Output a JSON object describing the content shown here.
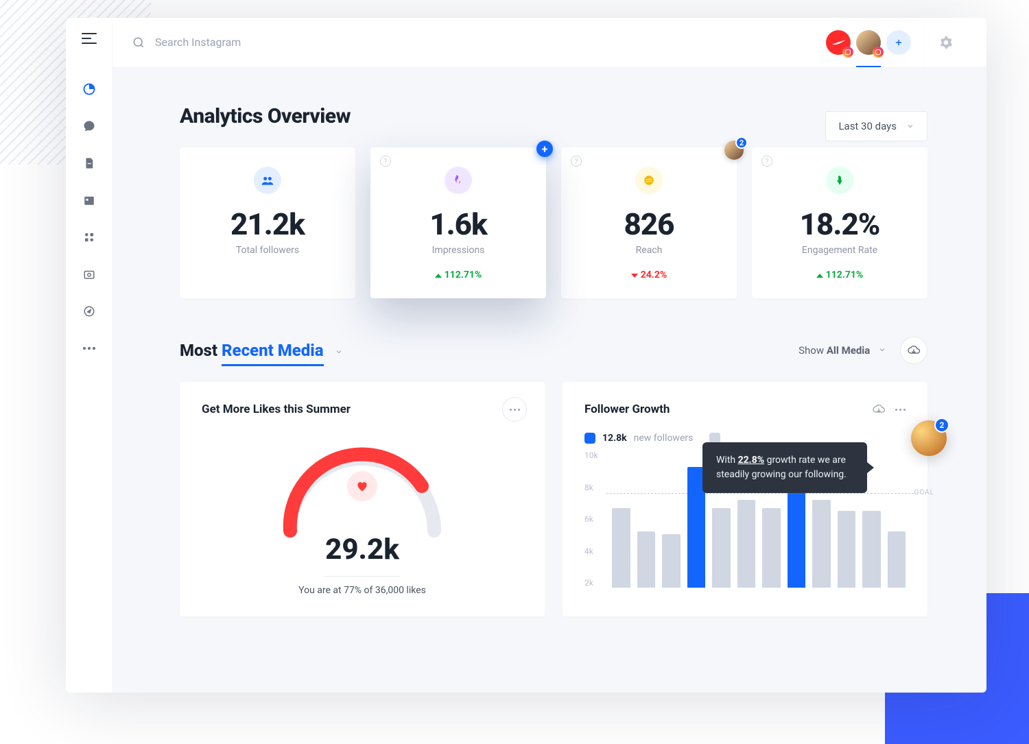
{
  "header": {
    "search_placeholder": "Search Instagram",
    "add_label": "+"
  },
  "date_range": {
    "label": "Last 30 days"
  },
  "overview": {
    "title": "Analytics Overview",
    "cards": [
      {
        "value": "21.2k",
        "label": "Total followers",
        "delta": null
      },
      {
        "value": "1.6k",
        "label": "Impressions",
        "delta": "112.71%",
        "direction": "up"
      },
      {
        "value": "826",
        "label": "Reach",
        "delta": "24.2%",
        "direction": "down"
      },
      {
        "value": "18.2%",
        "label": "Engagement Rate",
        "delta": "112.71%",
        "direction": "up"
      }
    ]
  },
  "media_section": {
    "title_prefix": "Most ",
    "title_accent": "Recent Media",
    "filter_prefix": "Show ",
    "filter_value": "All Media"
  },
  "gauge_panel": {
    "title": "Get More Likes this Summer",
    "value": "29.2k",
    "caption": "You are at 77% of 36,000 likes",
    "percent": 77
  },
  "growth_panel": {
    "title": "Follower Growth",
    "legend_value": "12.8k",
    "legend_label": "new followers",
    "tooltip_prefix": "With ",
    "tooltip_rate": "22.8%",
    "tooltip_rest": " growth rate we are steadily growing our following.",
    "goal_label": "GOAL",
    "collab_count": "2",
    "y_ticks": [
      "10k",
      "8k",
      "6k",
      "4k",
      "2k"
    ]
  },
  "chart_data": {
    "type": "bar",
    "title": "Follower Growth",
    "ylabel": "new followers",
    "ylim": [
      0,
      10000
    ],
    "goal": 6500,
    "highlighted_indices": [
      3,
      7
    ],
    "values": [
      5800,
      4100,
      3900,
      8800,
      5800,
      6400,
      5800,
      9700,
      6400,
      5600,
      5600,
      4100
    ],
    "tooltip_growth_rate_percent": 22.8
  },
  "gauge_chart": {
    "type": "gauge",
    "value": 29200,
    "target": 36000,
    "percent": 77,
    "label": "likes"
  }
}
